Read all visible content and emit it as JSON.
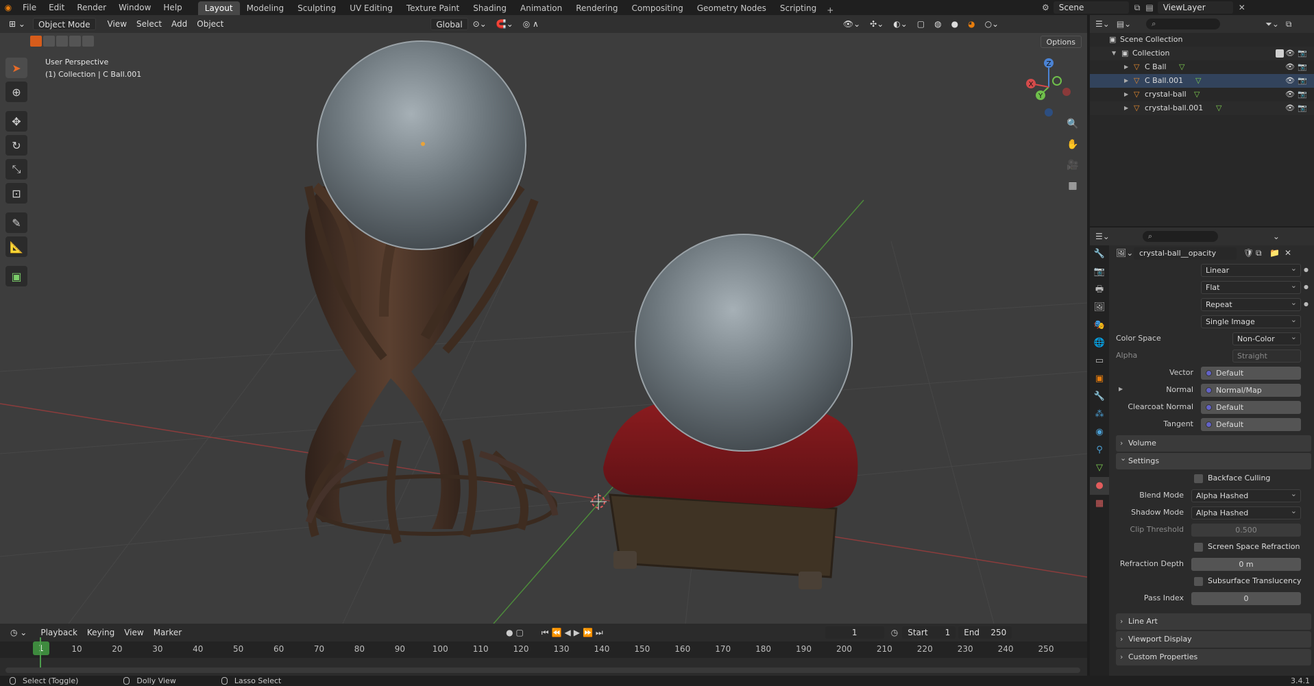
{
  "app": {
    "logo": "blender-logo",
    "menu": [
      "File",
      "Edit",
      "Render",
      "Window",
      "Help"
    ],
    "workspaces": [
      "Layout",
      "Modeling",
      "Sculpting",
      "UV Editing",
      "Texture Paint",
      "Shading",
      "Animation",
      "Rendering",
      "Compositing",
      "Geometry Nodes",
      "Scripting"
    ],
    "active_workspace": "Layout",
    "scene": "Scene",
    "view_layer": "ViewLayer"
  },
  "viewport": {
    "mode": "Object Mode",
    "menu": [
      "View",
      "Select",
      "Add",
      "Object"
    ],
    "transform_orientation": "Global",
    "options_label": "Options",
    "info_line1": "User Perspective",
    "info_line2": "(1) Collection | C Ball.001",
    "gizmo": {
      "z": "Z",
      "y": "Y",
      "x": "X"
    }
  },
  "timeline": {
    "menu": [
      "Playback",
      "Keying",
      "View",
      "Marker"
    ],
    "current_frame": "1",
    "start_label": "Start",
    "start": "1",
    "end_label": "End",
    "end": "250",
    "ticks": [
      1,
      10,
      20,
      30,
      40,
      50,
      60,
      70,
      80,
      90,
      100,
      110,
      120,
      130,
      140,
      150,
      160,
      170,
      180,
      190,
      200,
      210,
      220,
      230,
      240,
      250
    ]
  },
  "outliner": {
    "scene_collection": "Scene Collection",
    "collection": "Collection",
    "objects": [
      "C Ball",
      "C Ball.001",
      "crystal-ball",
      "crystal-ball.001"
    ]
  },
  "properties": {
    "image_name": "crystal-ball__opacity",
    "interpolation": "Linear",
    "projection": "Flat",
    "extension": "Repeat",
    "source": "Single Image",
    "color_space_label": "Color Space",
    "color_space": "Non-Color",
    "alpha_label": "Alpha",
    "alpha": "Straight",
    "sockets": [
      {
        "label": "Vector",
        "value": "Default"
      },
      {
        "label": "Normal",
        "value": "Normal/Map"
      },
      {
        "label": "Clearcoat Normal",
        "value": "Default"
      },
      {
        "label": "Tangent",
        "value": "Default"
      }
    ],
    "volume_panel": "Volume",
    "settings_panel": "Settings",
    "backface_culling": "Backface Culling",
    "blend_mode_label": "Blend Mode",
    "blend_mode": "Alpha Hashed",
    "shadow_mode_label": "Shadow Mode",
    "shadow_mode": "Alpha Hashed",
    "clip_threshold_label": "Clip Threshold",
    "clip_threshold": "0.500",
    "clip_threshold_fraction": 0.5,
    "screen_space_refraction": "Screen Space Refraction",
    "refraction_depth_label": "Refraction Depth",
    "refraction_depth": "0 m",
    "subsurface_translucency": "Subsurface Translucency",
    "pass_index_label": "Pass Index",
    "pass_index": "0",
    "line_art_panel": "Line Art",
    "viewport_display_panel": "Viewport Display",
    "custom_properties_panel": "Custom Properties"
  },
  "status": {
    "select": "Select (Toggle)",
    "dolly": "Dolly View",
    "lasso": "Lasso Select",
    "version": "3.4.1"
  },
  "colors": {
    "accent": "#e87d0d",
    "selection": "#32435c",
    "playhead": "#3e8a3e"
  }
}
